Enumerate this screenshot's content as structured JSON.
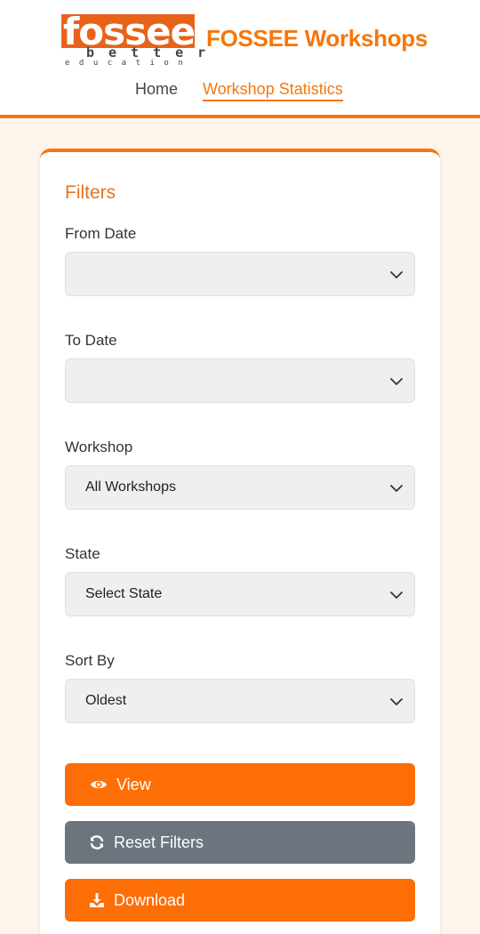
{
  "header": {
    "logo": {
      "word": "fossee",
      "tagline": "better",
      "subline": "education"
    },
    "brand": "FOSSEE Workshops",
    "nav": {
      "home": "Home",
      "stats": "Workshop Statistics"
    }
  },
  "filters": {
    "title": "Filters",
    "from_date": {
      "label": "From Date",
      "value": ""
    },
    "to_date": {
      "label": "To Date",
      "value": ""
    },
    "workshop": {
      "label": "Workshop",
      "value": "All Workshops"
    },
    "state": {
      "label": "State",
      "value": "Select State"
    },
    "sort_by": {
      "label": "Sort By",
      "value": "Oldest"
    }
  },
  "buttons": {
    "view": {
      "label": "View",
      "icon": "eye-icon"
    },
    "reset": {
      "label": "Reset Filters",
      "icon": "refresh-icon"
    },
    "download": {
      "label": "Download",
      "icon": "download-icon"
    }
  },
  "colors": {
    "accent": "#f7760b",
    "button_orange": "#fd6e06",
    "button_grey": "#6c757d",
    "page_bg": "#fdf4ec"
  }
}
